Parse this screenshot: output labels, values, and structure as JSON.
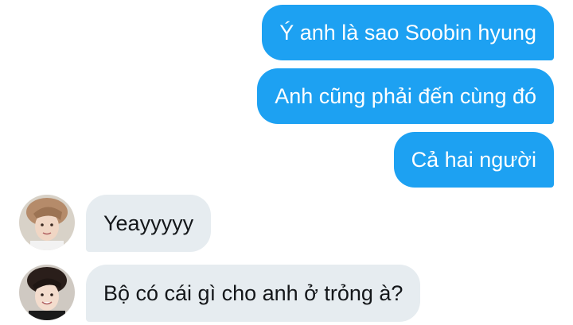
{
  "conversation": {
    "messages": [
      {
        "direction": "outgoing",
        "text": "Ý anh là sao Soobin hyung"
      },
      {
        "direction": "outgoing",
        "text": "Anh cũng phải đến cùng đó"
      },
      {
        "direction": "outgoing",
        "text": "Cả hai người"
      },
      {
        "direction": "incoming",
        "text": "Yeayyyyy",
        "avatar": "user-avatar-1"
      },
      {
        "direction": "incoming",
        "text": "Bộ có cái gì cho anh ở trỏng à?",
        "avatar": "user-avatar-2"
      }
    ]
  },
  "colors": {
    "outgoing_bubble": "#1da1f2",
    "outgoing_text": "#ffffff",
    "incoming_bubble": "#e6ecf0",
    "incoming_text": "#14171a",
    "background": "#ffffff"
  }
}
